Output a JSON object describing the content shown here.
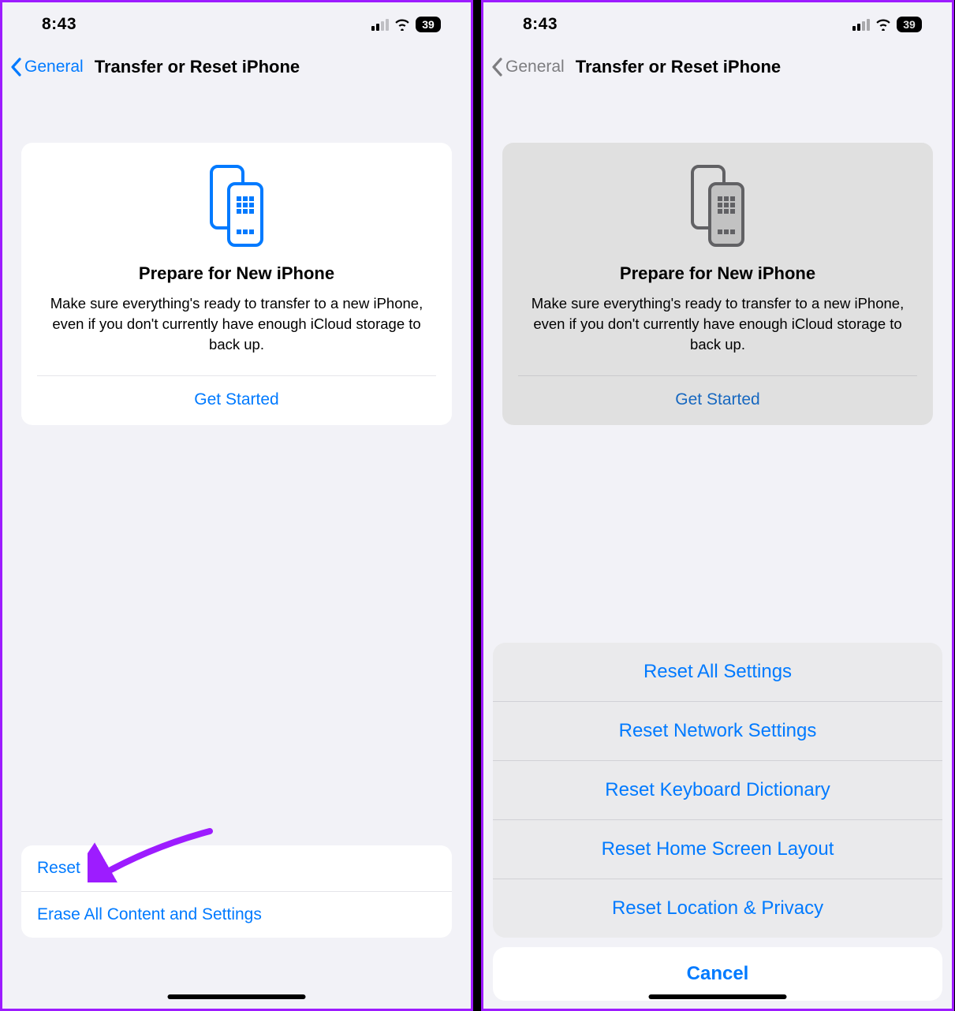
{
  "status": {
    "time": "8:43",
    "battery": "39"
  },
  "nav": {
    "back": "General",
    "title": "Transfer or Reset iPhone"
  },
  "card": {
    "title": "Prepare for New iPhone",
    "description": "Make sure everything's ready to transfer to a new iPhone, even if you don't currently have enough iCloud storage to back up.",
    "action": "Get Started"
  },
  "bottom_items": {
    "reset": "Reset",
    "erase": "Erase All Content and Settings"
  },
  "sheet": {
    "items": [
      "Reset All Settings",
      "Reset Network Settings",
      "Reset Keyboard Dictionary",
      "Reset Home Screen Layout",
      "Reset Location & Privacy"
    ],
    "cancel": "Cancel",
    "highlighted_index": 1
  },
  "colors": {
    "accent": "#007aff",
    "annotation": "#9d1cff"
  }
}
